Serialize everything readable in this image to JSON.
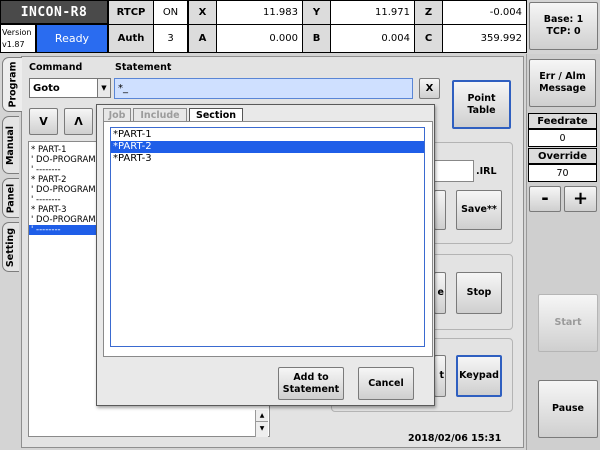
{
  "header": {
    "app_title": "INCON-R8",
    "version_label": "Version",
    "version": "v1.87",
    "status": "Ready",
    "rtcp_label": "RTCP",
    "rtcp_value": "ON",
    "auth_label": "Auth",
    "auth_value": "3",
    "axes": [
      {
        "name": "X",
        "value": "11.983"
      },
      {
        "name": "Y",
        "value": "11.971"
      },
      {
        "name": "Z",
        "value": "-0.004"
      },
      {
        "name": "A",
        "value": "0.000"
      },
      {
        "name": "B",
        "value": "0.004"
      },
      {
        "name": "C",
        "value": "359.992"
      }
    ],
    "base_tcp_line1": "Base: 1",
    "base_tcp_line2": "TCP: 0"
  },
  "side_tabs": [
    "Program",
    "Manual",
    "Panel",
    "Setting"
  ],
  "program": {
    "command_label": "Command",
    "statement_label": "Statement",
    "command_value": "Goto",
    "statement_value": "*_",
    "clear_label": "X",
    "down_label": "V",
    "up_label": "Λ",
    "point_table_line1": "Point",
    "point_table_line2": "Table",
    "code_lines": [
      "* PART-1",
      "' DO-PROGRAM",
      "' --------",
      "* PART-2",
      "' DO-PROGRAM",
      "' --------",
      "* PART-3",
      "' DO-PROGRAM",
      "' --------"
    ],
    "irl_label": ".IRL",
    "save_label": "Save**",
    "stop_label": "Stop",
    "keypad_label": "Keypad",
    "partial_label_1": "e",
    "partial_label_2": "t",
    "timestamp": "2018/02/06 15:31"
  },
  "dialog": {
    "tabs": [
      "Job",
      "Include",
      "Section"
    ],
    "items": [
      "*PART-1",
      "*PART-2",
      "*PART-3"
    ],
    "add_line1": "Add to",
    "add_line2": "Statement",
    "cancel_label": "Cancel"
  },
  "right_panel": {
    "err_line1": "Err / Alm",
    "err_line2": "Message",
    "feedrate_label": "Feedrate",
    "feedrate_value": "0",
    "override_label": "Override",
    "override_value": "70",
    "minus_label": "-",
    "plus_label": "+",
    "start_label": "Start",
    "pause_label": "Pause"
  }
}
